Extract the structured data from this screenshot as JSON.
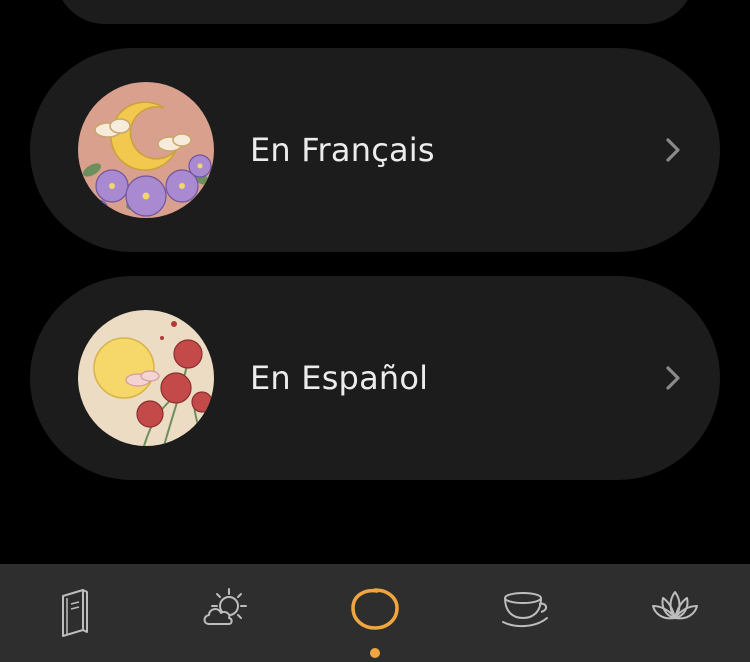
{
  "languages": [
    {
      "label": "En Français",
      "art_icon": "moon-flowers-art-icon"
    },
    {
      "label": "En Español",
      "art_icon": "sun-carnations-art-icon"
    }
  ],
  "tabbar": {
    "tabs": [
      {
        "icon": "book-icon"
      },
      {
        "icon": "sun-cloud-icon"
      },
      {
        "icon": "circle-icon",
        "active": true
      },
      {
        "icon": "tea-cup-icon"
      },
      {
        "icon": "lotus-icon"
      }
    ]
  },
  "colors": {
    "background": "#000000",
    "card": "#1c1c1c",
    "tabbar": "#2e2e2e",
    "accent": "#f0a640",
    "text": "#ececec",
    "icon": "#bdbdbd"
  }
}
